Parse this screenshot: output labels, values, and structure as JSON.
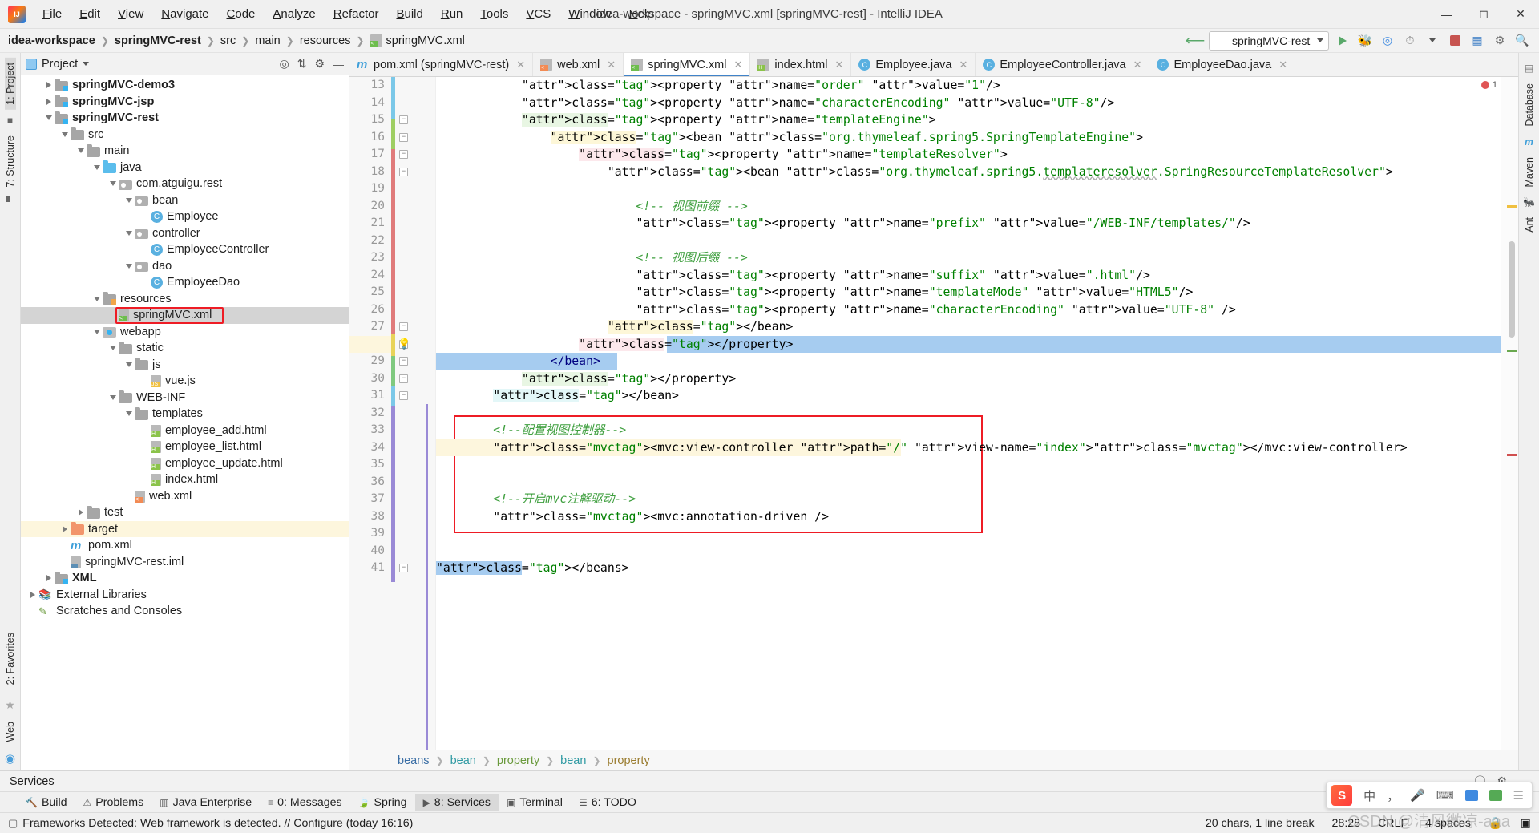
{
  "window": {
    "title": "idea-workspace - springMVC.xml [springMVC-rest] - IntelliJ IDEA",
    "logo_icon": "intellij-idea-logo",
    "minimize_icon": "minimize-icon",
    "maximize_icon": "maximize-icon",
    "close_icon": "close-icon"
  },
  "menubar": [
    {
      "label": "File"
    },
    {
      "label": "Edit"
    },
    {
      "label": "View"
    },
    {
      "label": "Navigate"
    },
    {
      "label": "Code"
    },
    {
      "label": "Analyze"
    },
    {
      "label": "Refactor"
    },
    {
      "label": "Build"
    },
    {
      "label": "Run"
    },
    {
      "label": "Tools"
    },
    {
      "label": "VCS"
    },
    {
      "label": "Window"
    },
    {
      "label": "Help"
    }
  ],
  "navbar": {
    "crumbs": [
      {
        "label": "idea-workspace",
        "bold": true
      },
      {
        "label": "springMVC-rest",
        "bold": true
      },
      {
        "label": "src",
        "bold": false
      },
      {
        "label": "main",
        "bold": false
      },
      {
        "label": "resources",
        "bold": false
      },
      {
        "label": "springMVC.xml",
        "bold": false
      }
    ],
    "hammer_icon": "build-hammer-icon",
    "run_config": "springMVC-rest",
    "run_icon": "run-icon",
    "debug_icon": "debug-icon",
    "run_coverage_icon": "run-with-coverage-icon",
    "profile_icon": "profile-icon",
    "stop_icon": "stop-icon",
    "layout_icon": "layout-icon",
    "settings_icon": "settings-gear-icon",
    "search_icon": "search-everywhere-icon"
  },
  "left_strip": {
    "project_tab": "1: Project",
    "structure_tab": "7: Structure",
    "favorites_tab": "2: Favorites",
    "web_tab": "Web",
    "commit_icon": "commit-icon",
    "build_icon": "build-variants-icon"
  },
  "right_strip": {
    "database_tab": "Database",
    "maven_tab": "Maven",
    "ant_tab": "Ant"
  },
  "project_panel": {
    "title": "Project",
    "locate_icon": "locate-file-icon",
    "collapse_icon": "collapse-all-icon",
    "settings_icon": "panel-settings-icon",
    "hide_icon": "hide-panel-icon",
    "tree": [
      {
        "label": "springMVC-demo3",
        "depth": 1,
        "arrow": "right",
        "icon": "module-folder",
        "bold": true
      },
      {
        "label": "springMVC-jsp",
        "depth": 1,
        "arrow": "right",
        "icon": "module-folder",
        "bold": true
      },
      {
        "label": "springMVC-rest",
        "depth": 1,
        "arrow": "down",
        "icon": "module-folder",
        "bold": true
      },
      {
        "label": "src",
        "depth": 2,
        "arrow": "down",
        "icon": "folder",
        "bold": false
      },
      {
        "label": "main",
        "depth": 3,
        "arrow": "down",
        "icon": "folder",
        "bold": false
      },
      {
        "label": "java",
        "depth": 4,
        "arrow": "down",
        "icon": "source-folder",
        "bold": false
      },
      {
        "label": "com.atguigu.rest",
        "depth": 5,
        "arrow": "down",
        "icon": "package",
        "bold": false
      },
      {
        "label": "bean",
        "depth": 6,
        "arrow": "down",
        "icon": "package",
        "bold": false
      },
      {
        "label": "Employee",
        "depth": 7,
        "arrow": "none",
        "icon": "java-class",
        "bold": false
      },
      {
        "label": "controller",
        "depth": 6,
        "arrow": "down",
        "icon": "package",
        "bold": false
      },
      {
        "label": "EmployeeController",
        "depth": 7,
        "arrow": "none",
        "icon": "java-class",
        "bold": false
      },
      {
        "label": "dao",
        "depth": 6,
        "arrow": "down",
        "icon": "package",
        "bold": false
      },
      {
        "label": "EmployeeDao",
        "depth": 7,
        "arrow": "none",
        "icon": "java-class",
        "bold": false
      },
      {
        "label": "resources",
        "depth": 4,
        "arrow": "down",
        "icon": "resources-folder",
        "bold": false
      },
      {
        "label": "springMVC.xml",
        "depth": 5,
        "arrow": "none",
        "icon": "xml-spring-file",
        "bold": false,
        "selected": true,
        "boxed": true
      },
      {
        "label": "webapp",
        "depth": 4,
        "arrow": "down",
        "icon": "webapp-folder",
        "bold": false
      },
      {
        "label": "static",
        "depth": 5,
        "arrow": "down",
        "icon": "folder",
        "bold": false
      },
      {
        "label": "js",
        "depth": 6,
        "arrow": "down",
        "icon": "folder",
        "bold": false
      },
      {
        "label": "vue.js",
        "depth": 7,
        "arrow": "none",
        "icon": "js-file",
        "bold": false
      },
      {
        "label": "WEB-INF",
        "depth": 5,
        "arrow": "down",
        "icon": "folder",
        "bold": false
      },
      {
        "label": "templates",
        "depth": 6,
        "arrow": "down",
        "icon": "folder",
        "bold": false
      },
      {
        "label": "employee_add.html",
        "depth": 7,
        "arrow": "none",
        "icon": "html-file",
        "bold": false
      },
      {
        "label": "employee_list.html",
        "depth": 7,
        "arrow": "none",
        "icon": "html-file",
        "bold": false
      },
      {
        "label": "employee_update.html",
        "depth": 7,
        "arrow": "none",
        "icon": "html-file",
        "bold": false
      },
      {
        "label": "index.html",
        "depth": 7,
        "arrow": "none",
        "icon": "html-file",
        "bold": false
      },
      {
        "label": "web.xml",
        "depth": 6,
        "arrow": "none",
        "icon": "xml-web-file",
        "bold": false
      },
      {
        "label": "test",
        "depth": 3,
        "arrow": "right",
        "icon": "folder",
        "bold": false
      },
      {
        "label": "target",
        "depth": 2,
        "arrow": "right",
        "icon": "excluded-folder",
        "bold": false,
        "highlight": true
      },
      {
        "label": "pom.xml",
        "depth": 2,
        "arrow": "none",
        "icon": "maven-file",
        "bold": false
      },
      {
        "label": "springMVC-rest.iml",
        "depth": 2,
        "arrow": "none",
        "icon": "iml-file",
        "bold": false
      },
      {
        "label": "XML",
        "depth": 1,
        "arrow": "right",
        "icon": "module-folder",
        "bold": true
      },
      {
        "label": "External Libraries",
        "depth": 0,
        "arrow": "right",
        "icon": "libraries",
        "bold": false
      },
      {
        "label": "Scratches and Consoles",
        "depth": 0,
        "arrow": "none",
        "icon": "scratches",
        "bold": false
      }
    ]
  },
  "editor": {
    "tabs": [
      {
        "label": "pom.xml (springMVC-rest)",
        "icon": "maven-file",
        "active": false,
        "closable": true
      },
      {
        "label": "web.xml",
        "icon": "xml-web-file",
        "active": false,
        "closable": true
      },
      {
        "label": "springMVC.xml",
        "icon": "xml-spring-file",
        "active": true,
        "closable": true
      },
      {
        "label": "index.html",
        "icon": "html-file",
        "active": false,
        "closable": true
      },
      {
        "label": "Employee.java",
        "icon": "java-class",
        "active": false,
        "closable": true
      },
      {
        "label": "EmployeeController.java",
        "icon": "java-class",
        "active": false,
        "closable": true
      },
      {
        "label": "EmployeeDao.java",
        "icon": "java-class",
        "active": false,
        "closable": true
      }
    ],
    "first_line_number": 13,
    "lines": [
      {
        "n": 13,
        "text": "            <property name=\"order\" value=\"1\"/>"
      },
      {
        "n": 14,
        "text": "            <property name=\"characterEncoding\" value=\"UTF-8\"/>"
      },
      {
        "n": 15,
        "text": "            <property name=\"templateEngine\">"
      },
      {
        "n": 16,
        "text": "                <bean class=\"org.thymeleaf.spring5.SpringTemplateEngine\">"
      },
      {
        "n": 17,
        "text": "                    <property name=\"templateResolver\">"
      },
      {
        "n": 18,
        "text": "                        <bean class=\"org.thymeleaf.spring5.templateresolver.SpringResourceTemplateResolver\">"
      },
      {
        "n": 19,
        "text": ""
      },
      {
        "n": 20,
        "text": "                            <!-- 视图前缀 -->"
      },
      {
        "n": 21,
        "text": "                            <property name=\"prefix\" value=\"/WEB-INF/templates/\"/>"
      },
      {
        "n": 22,
        "text": ""
      },
      {
        "n": 23,
        "text": "                            <!-- 视图后缀 -->"
      },
      {
        "n": 24,
        "text": "                            <property name=\"suffix\" value=\".html\"/>"
      },
      {
        "n": 25,
        "text": "                            <property name=\"templateMode\" value=\"HTML5\"/>"
      },
      {
        "n": 26,
        "text": "                            <property name=\"characterEncoding\" value=\"UTF-8\" />"
      },
      {
        "n": 27,
        "text": "                        </bean>"
      },
      {
        "n": 28,
        "text": "                    </property>"
      },
      {
        "n": 29,
        "text": "                </bean>"
      },
      {
        "n": 30,
        "text": "            </property>"
      },
      {
        "n": 31,
        "text": "        </bean>"
      },
      {
        "n": 32,
        "text": ""
      },
      {
        "n": 33,
        "text": "        <!--配置视图控制器-->"
      },
      {
        "n": 34,
        "text": "        <mvc:view-controller path=\"/\" view-name=\"index\"></mvc:view-controller>"
      },
      {
        "n": 35,
        "text": ""
      },
      {
        "n": 36,
        "text": ""
      },
      {
        "n": 37,
        "text": "        <!--开启mvc注解驱动-->"
      },
      {
        "n": 38,
        "text": "        <mvc:annotation-driven />"
      },
      {
        "n": 39,
        "text": ""
      },
      {
        "n": 40,
        "text": ""
      },
      {
        "n": 41,
        "text": "</beans>"
      }
    ],
    "breadcrumbs": [
      "beans",
      "bean",
      "property",
      "bean",
      "property"
    ],
    "error_count": "1"
  },
  "services_bar": {
    "title": "Services",
    "settings_icon": "settings-gear-icon",
    "help_icon": "help-icon",
    "hide_icon": "hide-icon"
  },
  "tool_windows": [
    {
      "label": "Build",
      "icon": "build-hammer-icon",
      "active": false
    },
    {
      "label": "Problems",
      "icon": "warning-triangle-icon",
      "active": false
    },
    {
      "label": "Java Enterprise",
      "icon": "java-enterprise-icon",
      "active": false
    },
    {
      "label": "0: Messages",
      "icon": "messages-icon",
      "active": false
    },
    {
      "label": "Spring",
      "icon": "spring-leaf-icon",
      "active": false
    },
    {
      "label": "8: Services",
      "icon": "services-icon",
      "active": true
    },
    {
      "label": "Terminal",
      "icon": "terminal-icon",
      "active": false
    },
    {
      "label": "6: TODO",
      "icon": "todo-list-icon",
      "active": false
    }
  ],
  "statusbar": {
    "message": "Frameworks Detected: Web framework is detected. // Configure (today 16:16)",
    "message_icon": "notification-icon",
    "chars": "20 chars, 1 line break",
    "caret": "28:28",
    "line_separator": "CRLF",
    "indent": "4 spaces",
    "encoding_icon": "encoding-icon",
    "lock_icon": "lock-icon"
  },
  "ime": {
    "logo": "sogou-ime-logo",
    "lang": "中",
    "comma": "，",
    "mic_icon": "microphone-icon",
    "keyboard_icon": "keyboard-icon",
    "toolbox_icon": "toolbox-icon",
    "menu_icon": "hamburger-icon"
  },
  "watermark": "CSDN @清风微凉-aaa",
  "colors": {
    "accent": "#4083c9",
    "error": "#e05555",
    "red_box": "#ee1c25",
    "selection": "#a6ccf0",
    "run_green": "#59a869"
  }
}
